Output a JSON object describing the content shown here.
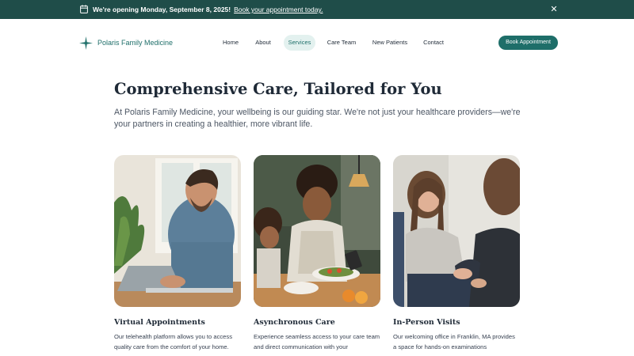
{
  "announcement": {
    "message": "We're opening Monday, September 8, 2025!",
    "link": "Book your appointment today.",
    "close_glyph": "✕",
    "icon": "calendar-icon"
  },
  "brand": {
    "name": "Polaris Family Medicine",
    "icon": "star-icon",
    "color": "#1f6f6a"
  },
  "nav": {
    "items": [
      "Home",
      "About",
      "Services",
      "Care Team",
      "New Patients",
      "Contact"
    ],
    "active": "Services"
  },
  "cta": {
    "label": "Book Appointment",
    "color": "#1e6e69"
  },
  "hero": {
    "title": "Comprehensive Care, Tailored for You",
    "subtitle": "At Polaris Family Medicine, your wellbeing is our guiding star. We're not just your healthcare providers—we're your partners in creating a healthier, more vibrant life."
  },
  "cards": [
    {
      "title": "Virtual Appointments",
      "description": "Our telehealth platform allows you to access quality care from the comfort of your home."
    },
    {
      "title": "Asynchronous Care",
      "description": "Experience seamless access to your care team and direct communication with your"
    },
    {
      "title": "In-Person Visits",
      "description": "Our welcoming office in Franklin, MA provides a space for hands-on examinations"
    }
  ],
  "colors": {
    "announce_bg": "#1f4d49",
    "accent": "#1e6e69",
    "active_pill": "#e3f1ef"
  }
}
